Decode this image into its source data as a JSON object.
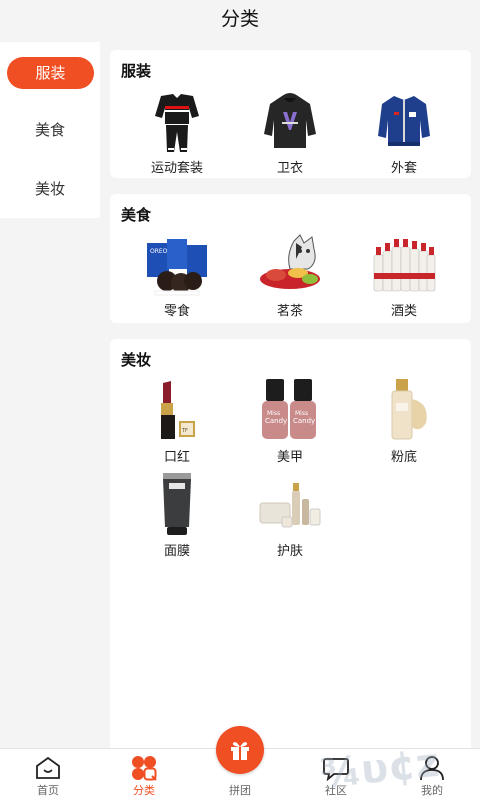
{
  "header": {
    "title": "分类"
  },
  "sidebar": {
    "items": [
      {
        "label": "服装",
        "active": true
      },
      {
        "label": "美食",
        "active": false
      },
      {
        "label": "美妆",
        "active": false
      }
    ]
  },
  "sections": [
    {
      "title": "服装",
      "items": [
        {
          "label": "运动套装",
          "icon": "tracksuit-image"
        },
        {
          "label": "卫衣",
          "icon": "hoodie-image"
        },
        {
          "label": "外套",
          "icon": "jacket-image"
        }
      ]
    },
    {
      "title": "美食",
      "items": [
        {
          "label": "零食",
          "icon": "cookies-image"
        },
        {
          "label": "茗茶",
          "icon": "tea-image"
        },
        {
          "label": "酒类",
          "icon": "liquor-bottles-image"
        }
      ]
    },
    {
      "title": "美妆",
      "items": [
        {
          "label": "口红",
          "icon": "lipstick-image"
        },
        {
          "label": "美甲",
          "icon": "nail-polish-image"
        },
        {
          "label": "粉底",
          "icon": "foundation-image"
        },
        {
          "label": "面膜",
          "icon": "face-mask-tube-image"
        },
        {
          "label": "护肤",
          "icon": "skincare-set-image"
        }
      ]
    }
  ],
  "tabbar": {
    "tabs": [
      {
        "label": "首页",
        "icon": "home-icon",
        "active": false
      },
      {
        "label": "分类",
        "icon": "category-icon",
        "active": true
      },
      {
        "label": "拼团",
        "icon": "gift-icon",
        "active": false
      },
      {
        "label": "社区",
        "icon": "chat-bubble-icon",
        "active": false
      },
      {
        "label": "我的",
        "icon": "user-icon",
        "active": false
      }
    ]
  },
  "colors": {
    "accent": "#f04e23",
    "background": "#f4f4f4",
    "card": "#ffffff"
  }
}
